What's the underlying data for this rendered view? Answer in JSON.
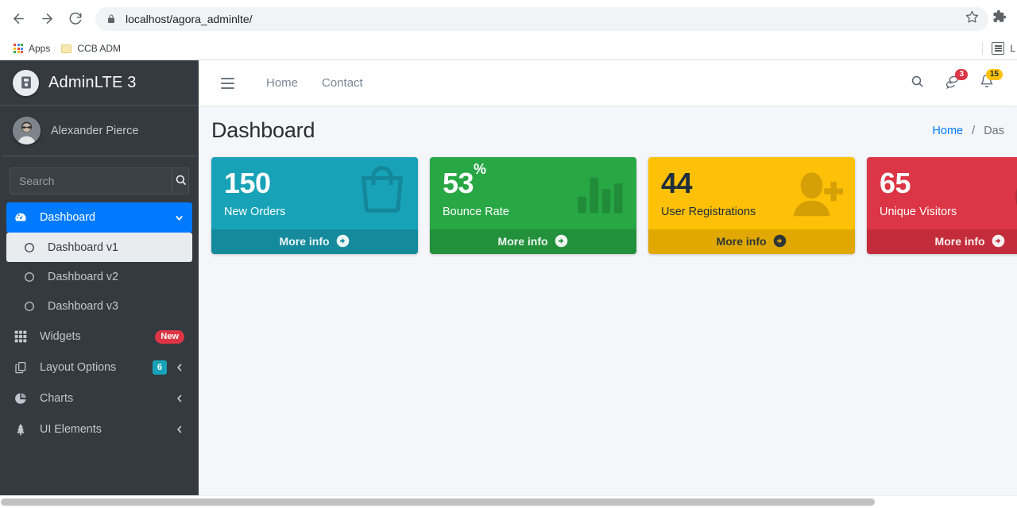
{
  "browser": {
    "back_icon": "back-arrow-icon",
    "forward_icon": "forward-arrow-icon",
    "reload_icon": "reload-icon",
    "lock_icon": "lock-icon",
    "url": "localhost/agora_adminlte/",
    "star_icon": "bookmark-star-icon",
    "extensions_icon": "puzzle-piece-icon",
    "bookmarks": [
      {
        "label": "Apps",
        "icon": "apps-grid-icon"
      },
      {
        "label": "CCB ADM",
        "icon": "folder-icon"
      }
    ],
    "reading_list": {
      "label": "L",
      "icon": "reading-list-icon"
    }
  },
  "sidebar": {
    "brand": {
      "text": "AdminLTE 3",
      "logo_icon": "adminlte-logo-icon"
    },
    "user": {
      "name": "Alexander Pierce",
      "avatar_icon": "user-avatar"
    },
    "search": {
      "placeholder": "Search",
      "value": "",
      "button_icon": "search-icon"
    },
    "items": [
      {
        "label": "Dashboard",
        "icon": "tachometer-icon",
        "state": "active",
        "chevron": "chevron-down-icon",
        "children": [
          {
            "label": "Dashboard v1",
            "icon": "circle-icon",
            "state": "hovered"
          },
          {
            "label": "Dashboard v2",
            "icon": "circle-icon",
            "state": "normal"
          },
          {
            "label": "Dashboard v3",
            "icon": "circle-icon",
            "state": "normal"
          }
        ]
      },
      {
        "label": "Widgets",
        "icon": "grid-icon",
        "state": "normal",
        "badge": {
          "text": "New",
          "color": "#dc3545",
          "shape": "pill"
        }
      },
      {
        "label": "Layout Options",
        "icon": "copy-icon",
        "state": "normal",
        "badge": {
          "text": "6",
          "color": "#17a2b8",
          "shape": "square"
        },
        "chevron": "chevron-left-icon"
      },
      {
        "label": "Charts",
        "icon": "pie-chart-icon",
        "state": "normal",
        "chevron": "chevron-left-icon"
      },
      {
        "label": "UI Elements",
        "icon": "tree-icon",
        "state": "normal",
        "chevron": "chevron-left-icon"
      }
    ]
  },
  "navbar": {
    "menu_toggle_icon": "hamburger-icon",
    "links": [
      {
        "label": "Home"
      },
      {
        "label": "Contact"
      }
    ],
    "actions": [
      {
        "icon": "search-icon",
        "badge": null
      },
      {
        "icon": "comments-icon",
        "badge": {
          "text": "3",
          "color": "#dc3545",
          "text_color": "#ffffff"
        }
      },
      {
        "icon": "bell-icon",
        "badge": {
          "text": "15",
          "color": "#ffc107",
          "text_color": "#1f2d3d"
        }
      }
    ]
  },
  "content": {
    "title": "Dashboard",
    "breadcrumb": {
      "home": "Home",
      "separator": "/",
      "current": "Das"
    },
    "boxes": [
      {
        "value": "150",
        "suffix": "",
        "label": "New Orders",
        "footer": "More info",
        "bg": "#17a2b8",
        "footer_bg": "#148a9c",
        "icon": "shopping-bag-icon",
        "text_mode": "light"
      },
      {
        "value": "53",
        "suffix": "%",
        "label": "Bounce Rate",
        "footer": "More info",
        "bg": "#28a745",
        "footer_bg": "#23913c",
        "icon": "bar-chart-icon",
        "text_mode": "light"
      },
      {
        "value": "44",
        "suffix": "",
        "label": "User Registrations",
        "footer": "More info",
        "bg": "#ffc107",
        "footer_bg": "#e0a800",
        "icon": "user-plus-icon",
        "text_mode": "dark"
      },
      {
        "value": "65",
        "suffix": "",
        "label": "Unique Visitors",
        "footer": "More info",
        "bg": "#dc3545",
        "footer_bg": "#c42c3b",
        "icon": "chart-pie-icon",
        "text_mode": "light"
      }
    ]
  }
}
